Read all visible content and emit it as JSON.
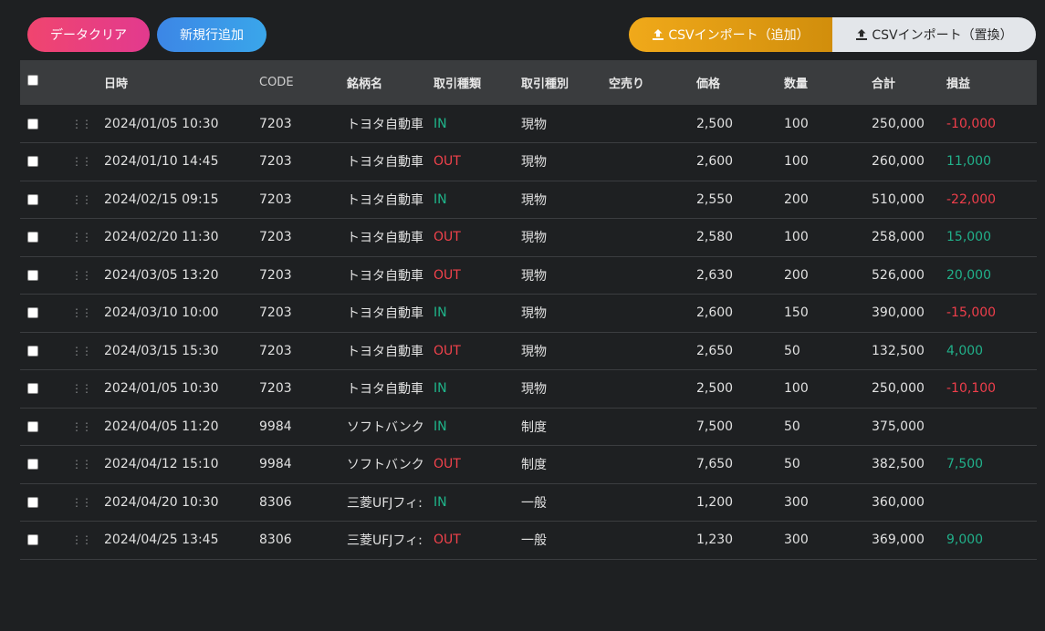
{
  "toolbar": {
    "clear_label": "データクリア",
    "add_row_label": "新規行追加",
    "import_add_label": "CSVインポート（追加）",
    "import_replace_label": "CSVインポート（置換）"
  },
  "table": {
    "headers": {
      "datetime": "日時",
      "code": "CODE",
      "name": "銘柄名",
      "trade_type": "取引種類",
      "trade_kind": "取引種別",
      "short": "空売り",
      "price": "価格",
      "qty": "数量",
      "total": "合計",
      "pl": "損益"
    },
    "rows": [
      {
        "datetime": "2024/01/05 10:30",
        "code": "7203",
        "name": "トヨタ自動車",
        "trade_type": "IN",
        "trade_kind": "現物",
        "short": "",
        "price": "2,500",
        "qty": "100",
        "total": "250,000",
        "pl": "-10,000"
      },
      {
        "datetime": "2024/01/10 14:45",
        "code": "7203",
        "name": "トヨタ自動車",
        "trade_type": "OUT",
        "trade_kind": "現物",
        "short": "",
        "price": "2,600",
        "qty": "100",
        "total": "260,000",
        "pl": "11,000"
      },
      {
        "datetime": "2024/02/15 09:15",
        "code": "7203",
        "name": "トヨタ自動車",
        "trade_type": "IN",
        "trade_kind": "現物",
        "short": "",
        "price": "2,550",
        "qty": "200",
        "total": "510,000",
        "pl": "-22,000"
      },
      {
        "datetime": "2024/02/20 11:30",
        "code": "7203",
        "name": "トヨタ自動車",
        "trade_type": "OUT",
        "trade_kind": "現物",
        "short": "",
        "price": "2,580",
        "qty": "100",
        "total": "258,000",
        "pl": "15,000"
      },
      {
        "datetime": "2024/03/05 13:20",
        "code": "7203",
        "name": "トヨタ自動車",
        "trade_type": "OUT",
        "trade_kind": "現物",
        "short": "",
        "price": "2,630",
        "qty": "200",
        "total": "526,000",
        "pl": "20,000"
      },
      {
        "datetime": "2024/03/10 10:00",
        "code": "7203",
        "name": "トヨタ自動車",
        "trade_type": "IN",
        "trade_kind": "現物",
        "short": "",
        "price": "2,600",
        "qty": "150",
        "total": "390,000",
        "pl": "-15,000"
      },
      {
        "datetime": "2024/03/15 15:30",
        "code": "7203",
        "name": "トヨタ自動車",
        "trade_type": "OUT",
        "trade_kind": "現物",
        "short": "",
        "price": "2,650",
        "qty": "50",
        "total": "132,500",
        "pl": "4,000"
      },
      {
        "datetime": "2024/01/05 10:30",
        "code": "7203",
        "name": "トヨタ自動車",
        "trade_type": "IN",
        "trade_kind": "現物",
        "short": "",
        "price": "2,500",
        "qty": "100",
        "total": "250,000",
        "pl": "-10,100"
      },
      {
        "datetime": "2024/04/05 11:20",
        "code": "9984",
        "name": "ソフトバンク",
        "trade_type": "IN",
        "trade_kind": "制度",
        "short": "",
        "price": "7,500",
        "qty": "50",
        "total": "375,000",
        "pl": ""
      },
      {
        "datetime": "2024/04/12 15:10",
        "code": "9984",
        "name": "ソフトバンク",
        "trade_type": "OUT",
        "trade_kind": "制度",
        "short": "",
        "price": "7,650",
        "qty": "50",
        "total": "382,500",
        "pl": "7,500"
      },
      {
        "datetime": "2024/04/20 10:30",
        "code": "8306",
        "name": "三菱UFJフィ:",
        "trade_type": "IN",
        "trade_kind": "一般",
        "short": "",
        "price": "1,200",
        "qty": "300",
        "total": "360,000",
        "pl": ""
      },
      {
        "datetime": "2024/04/25 13:45",
        "code": "8306",
        "name": "三菱UFJフィ:",
        "trade_type": "OUT",
        "trade_kind": "一般",
        "short": "",
        "price": "1,230",
        "qty": "300",
        "total": "369,000",
        "pl": "9,000"
      }
    ]
  },
  "icons": {
    "drag": "drag-handle-icon",
    "upload": "upload-icon"
  },
  "colors": {
    "in": "#1fb58a",
    "out": "#f0424b",
    "pl_negative": "#ef3e4b",
    "pl_positive": "#21b08a"
  }
}
